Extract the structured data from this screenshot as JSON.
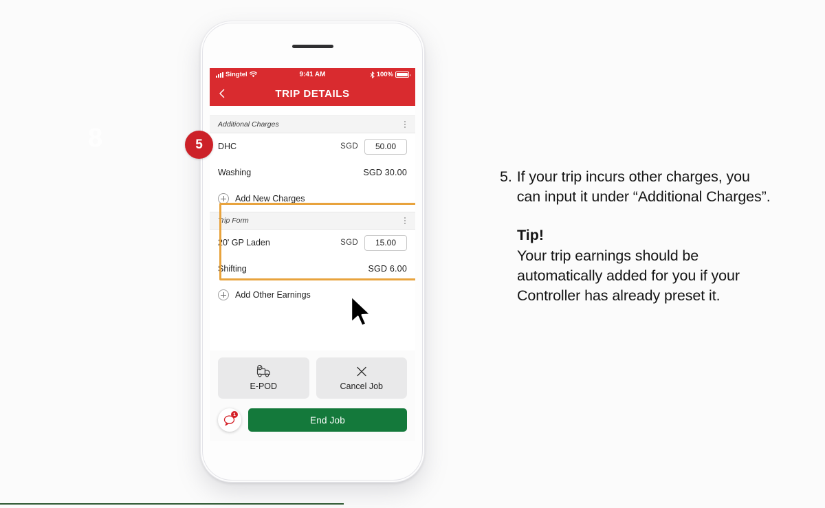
{
  "page": {
    "background_color": "#fbfbfb",
    "watermark_text": "8",
    "bottom_rule_color": "#2f5a33"
  },
  "step_badge": {
    "number": "5",
    "color": "#cc2128"
  },
  "phone": {
    "status_bar": {
      "carrier": "Singtel",
      "time": "9:41 AM",
      "battery_percent": "100%",
      "wifi_icon": "wifi-icon",
      "signal_icon": "signal-bars-icon",
      "bluetooth_icon": "bluetooth-icon",
      "battery_icon": "battery-icon",
      "background_color": "#d92b2f"
    },
    "nav_bar": {
      "title": "TRIP DETAILS",
      "back_icon": "back-chevron-icon",
      "background_color": "#d92b2f"
    },
    "sections": [
      {
        "id": "additional-charges",
        "title": "Additional Charges",
        "menu_icon": "kebab-menu-icon",
        "highlighted": true,
        "highlight_color": "#e8a33d",
        "rows": [
          {
            "name": "DHC",
            "currency": "SGD",
            "value": "50.00",
            "editable": true
          },
          {
            "name": "Washing",
            "currency": "SGD",
            "amount": "SGD 30.00",
            "editable": false
          }
        ],
        "add_action": {
          "label": "Add New Charges",
          "icon": "plus-circle-icon"
        }
      },
      {
        "id": "trip-form",
        "title": "Trip Form",
        "menu_icon": "kebab-menu-icon",
        "highlighted": false,
        "rows": [
          {
            "name": "20' GP Laden",
            "currency": "SGD",
            "value": "15.00",
            "editable": true
          },
          {
            "name": "Shifting",
            "currency": "SGD",
            "amount": "SGD 6.00",
            "editable": false
          }
        ],
        "add_action": {
          "label": "Add Other Earnings",
          "icon": "plus-circle-icon"
        }
      }
    ],
    "actions": {
      "epod": {
        "label": "E-POD",
        "icon": "truck-check-icon"
      },
      "cancel_job": {
        "label": "Cancel Job",
        "icon": "close-x-icon"
      },
      "chat": {
        "icon": "chat-bubble-icon",
        "badge": "1",
        "color": "#d42027"
      },
      "end_job": {
        "label": "End Job",
        "color": "#14793b"
      }
    }
  },
  "instructions": {
    "step_number": "5.",
    "step_text": "If your trip incurs other charges, you can input it under “Additional Charges”.",
    "tip_title": "Tip!",
    "tip_text": "Your trip earnings should be automatically added for you if your Controller has already preset it."
  }
}
